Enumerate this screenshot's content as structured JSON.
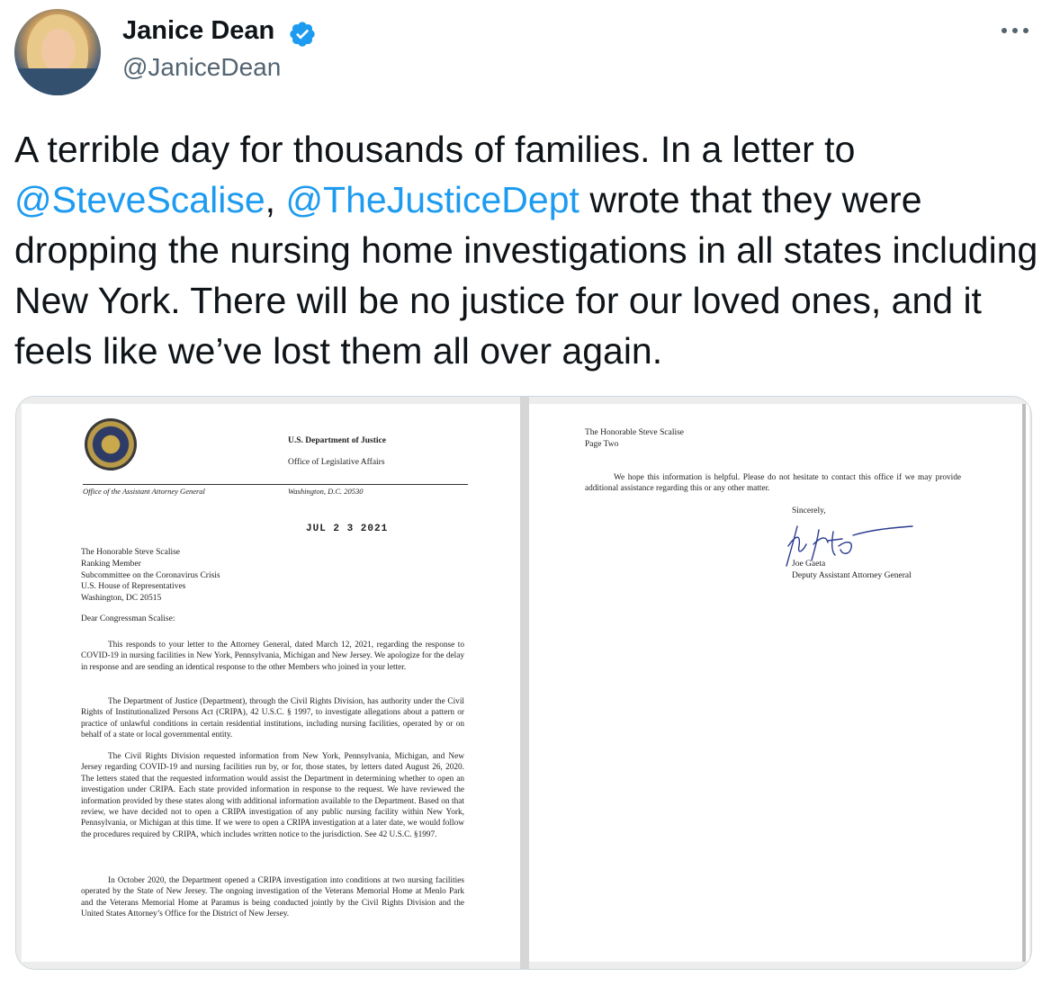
{
  "author": {
    "name": "Janice Dean",
    "handle": "@JaniceDean",
    "verified": true
  },
  "tweet": {
    "text_part1": "A terrible day for thousands of families. In a letter to ",
    "mention1": "@SteveScalise",
    "separator": ", ",
    "mention2": "@TheJusticeDept",
    "text_part2": " wrote that they were dropping the nursing home investigations in all states including New York. There will be no justice for our loved ones, and it feels like we’ve lost them all over again."
  },
  "letter_page1": {
    "agency": "U.S. Department of Justice",
    "office": "Office of Legislative Affairs",
    "office_left": "Office of the Assistant Attorney General",
    "office_right": "Washington, D.C. 20530",
    "date_stamp": "JUL 2 3 2021",
    "address": [
      "The Honorable Steve Scalise",
      "Ranking Member",
      "Subcommittee on the Coronavirus Crisis",
      "U.S. House of Representatives",
      "Washington, DC  20515"
    ],
    "salutation": "Dear Congressman Scalise:",
    "paragraphs": [
      "This responds to your letter to the Attorney General, dated March 12, 2021, regarding the response to COVID-19 in nursing facilities in New York, Pennsylvania, Michigan and New Jersey. We apologize for the delay in response and are sending an identical response to the other Members who joined in your letter.",
      "The Department of Justice (Department), through the Civil Rights Division, has authority under the Civil Rights of Institutionalized Persons Act (CRIPA), 42 U.S.C. § 1997, to investigate allegations about a pattern or practice of unlawful conditions in certain residential institutions, including nursing facilities, operated by or on behalf of a state or local governmental entity.",
      "The Civil Rights Division requested information from New York, Pennsylvania, Michigan, and New Jersey regarding COVID-19 and nursing facilities run by, or for, those states, by letters dated August 26, 2020. The letters stated that the requested information would assist the Department in determining whether to open an investigation under CRIPA. Each state provided information in response to the request. We have reviewed the information provided by these states along with additional information available to the Department. Based on that review, we have decided not to open a CRIPA investigation of any public nursing facility within New York, Pennsylvania, or Michigan at this time. If we were to open a CRIPA investigation at a later date, we would follow the procedures required by CRIPA, which includes written notice to the jurisdiction. See 42 U.S.C. §1997.",
      "In October 2020, the Department opened a CRIPA investigation into conditions at two nursing facilities operated by the State of New Jersey. The ongoing investigation of the Veterans Memorial Home at Menlo Park and the Veterans Memorial Home at Paramus is being conducted jointly by the Civil Rights Division and the United States Attorney’s Office for the District of New Jersey."
    ]
  },
  "letter_page2": {
    "header_line1": "The Honorable Steve Scalise",
    "header_line2": "Page Two",
    "paragraph": "We hope this information is helpful. Please do not hesitate to contact this office if we may provide additional assistance regarding this or any other matter.",
    "closing": "Sincerely,",
    "signer_name": "Joe Gaeta",
    "signer_title": "Deputy Assistant Attorney General"
  },
  "colors": {
    "mention": "#1d9bf0",
    "verified": "#1d9bf0",
    "handle": "#536471"
  },
  "icons": {
    "verified": "verified-badge-icon",
    "more": "more-options-icon"
  }
}
